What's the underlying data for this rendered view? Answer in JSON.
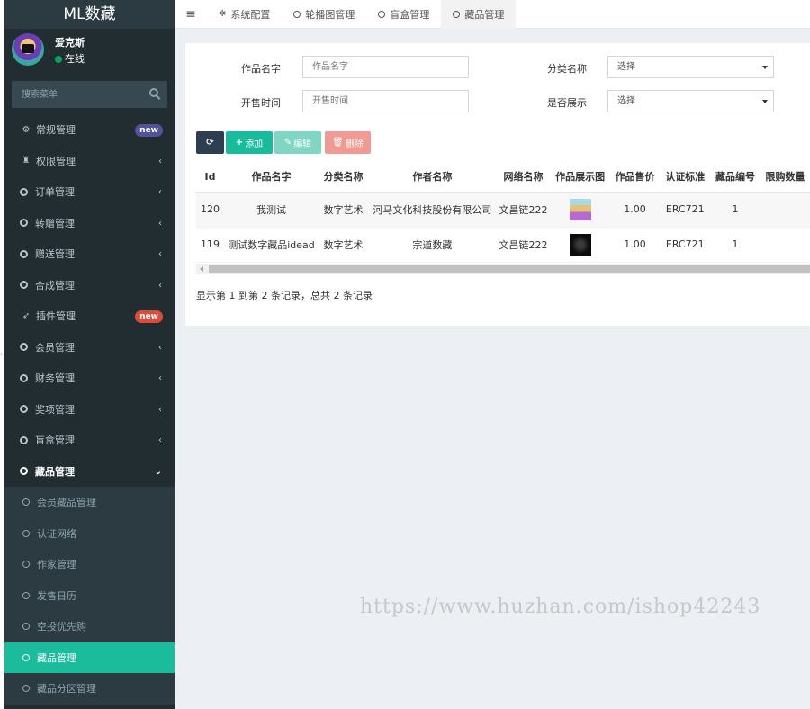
{
  "sidebar": {
    "brand": "ML数藏",
    "user": {
      "name": "爱克斯",
      "status": "在线"
    },
    "search_placeholder": "搜索菜单",
    "menu": [
      {
        "label": "常规管理",
        "icon": "cogs-icon",
        "badge": "new",
        "badge_color": "#555299"
      },
      {
        "label": "权限管理",
        "icon": "group-icon"
      },
      {
        "label": "订单管理",
        "icon": "circle-icon"
      },
      {
        "label": "转赠管理",
        "icon": "circle-icon"
      },
      {
        "label": "赠送管理",
        "icon": "circle-icon"
      },
      {
        "label": "合成管理",
        "icon": "circle-icon"
      },
      {
        "label": "插件管理",
        "icon": "rocket-icon",
        "badge": "new",
        "badge_color": "#dd4b39"
      },
      {
        "label": "会员管理",
        "icon": "circle-icon"
      },
      {
        "label": "财务管理",
        "icon": "circle-icon"
      },
      {
        "label": "奖项管理",
        "icon": "circle-icon"
      },
      {
        "label": "盲盒管理",
        "icon": "circle-icon"
      },
      {
        "label": "藏品管理",
        "icon": "circle-icon",
        "expanded": true
      }
    ],
    "submenu": [
      {
        "label": "会员藏品管理"
      },
      {
        "label": "认证网络"
      },
      {
        "label": "作家管理"
      },
      {
        "label": "发售日历"
      },
      {
        "label": "空投优先购"
      },
      {
        "label": "藏品管理",
        "active": true
      },
      {
        "label": "藏品分区管理"
      }
    ]
  },
  "tabs": [
    {
      "label": "系统配置",
      "icon": "gear-icon"
    },
    {
      "label": "轮播图管理",
      "icon": "circle-icon"
    },
    {
      "label": "盲盒管理",
      "icon": "circle-icon"
    },
    {
      "label": "藏品管理",
      "icon": "circle-icon",
      "active": true
    }
  ],
  "filters": {
    "name_label": "作品名字",
    "name_placeholder": "作品名字",
    "category_label": "分类名称",
    "category_value": "选择",
    "sale_time_label": "开售时间",
    "sale_time_placeholder": "开售时间",
    "show_label": "是否展示",
    "show_value": "选择"
  },
  "toolbar": {
    "add": "添加",
    "edit": "编辑",
    "delete": "删除"
  },
  "table": {
    "headers": [
      "Id",
      "作品名字",
      "分类名称",
      "作者名称",
      "网络名称",
      "作品展示图",
      "作品售价",
      "认证标准",
      "藏品编号",
      "限购数量"
    ],
    "rows": [
      {
        "id": "120",
        "name": "我测试",
        "category": "数字艺术",
        "author": "河马文化科技股份有限公司",
        "network": "文昌链222",
        "price": "1.00",
        "standard": "ERC721",
        "number": "1"
      },
      {
        "id": "119",
        "name": "测试数字藏品idead",
        "category": "数字艺术",
        "author": "宗道数藏",
        "network": "文昌链222",
        "price": "1.00",
        "standard": "ERC721",
        "number": "1"
      }
    ]
  },
  "pager_info": "显示第 1 到第 2 条记录，总共 2 条记录",
  "watermark": "https://www.huzhan.com/ishop42243",
  "colors": {
    "sidebar_bg": "#222d32",
    "active": "#1abc9c",
    "primary_dark": "#2c3e50",
    "success": "#18bc9c",
    "danger": "#ef9a92"
  }
}
